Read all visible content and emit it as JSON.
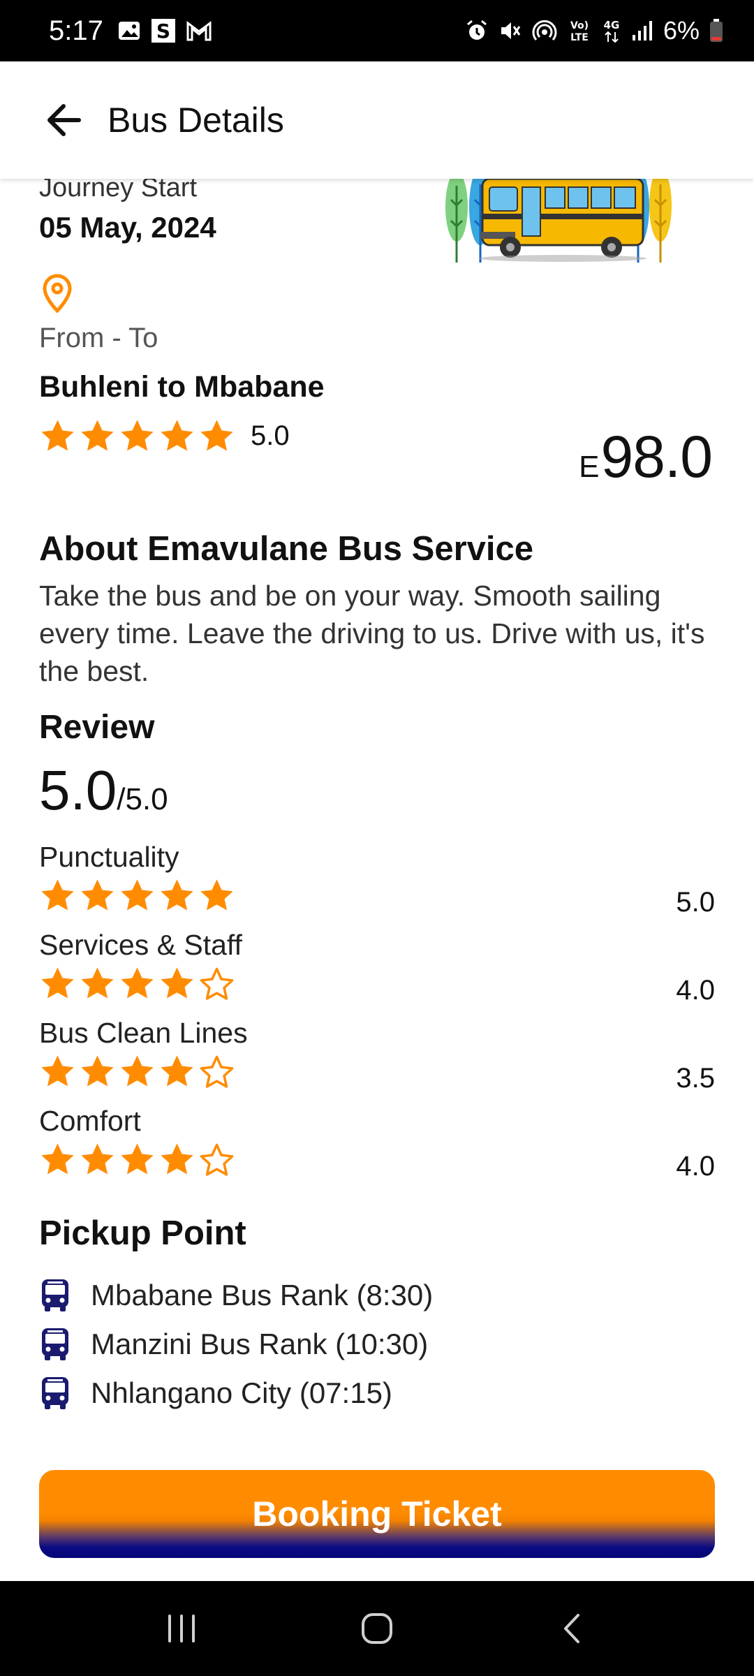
{
  "status_bar": {
    "time": "5:17",
    "battery": "6%",
    "left_icons": [
      "gallery-icon",
      "s-app-icon",
      "gmail-icon"
    ],
    "right_icons": [
      "alarm-icon",
      "mute-icon",
      "hotspot-icon",
      "volte-icon",
      "4g-icon",
      "signal-icon",
      "battery-icon"
    ],
    "volte": "Vo) LTE",
    "network": "4G"
  },
  "header": {
    "title": "Bus Details",
    "back_icon": "arrow-left-icon"
  },
  "journey": {
    "label": "Journey Start",
    "date": "05 May, 2024",
    "image": "school-bus-illustration"
  },
  "route": {
    "label": "From - To",
    "value": "Buhleni to Mbabane",
    "rating": "5.0",
    "stars": 5,
    "price_currency": "E",
    "price": "98.0"
  },
  "about": {
    "title": "About Emavulane Bus Service",
    "text": "Take the bus and be on your way. Smooth sailing every time. Leave the driving to us. Drive with us, it's the best."
  },
  "review": {
    "title": "Review",
    "overall": "5.0",
    "overall_max": "/5.0",
    "categories": [
      {
        "label": "Punctuality",
        "value": "5.0",
        "filled": 5
      },
      {
        "label": "Services & Staff",
        "value": "4.0",
        "filled": 4
      },
      {
        "label": "Bus Clean Lines",
        "value": "3.5",
        "filled": 4
      },
      {
        "label": "Comfort",
        "value": "4.0",
        "filled": 4
      }
    ]
  },
  "pickup": {
    "title": "Pickup Point",
    "items": [
      {
        "label": "Mbabane Bus Rank (8:30)"
      },
      {
        "label": "Manzini Bus Rank (10:30)"
      },
      {
        "label": "Nhlangano City (07:15)"
      }
    ]
  },
  "button": {
    "label": "Booking Ticket"
  },
  "colors": {
    "accent": "#ff8c00",
    "navy": "#0a0a82",
    "bus_icon": "#1a1a6e"
  }
}
